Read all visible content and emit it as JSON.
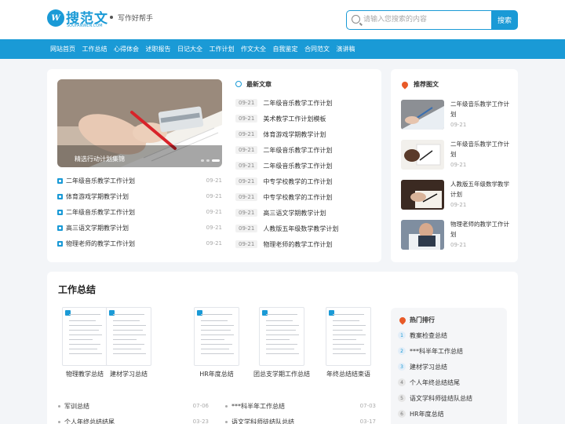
{
  "header": {
    "logo_mark": "W",
    "logo_text": "搜范文",
    "logo_sub": "SOUFANWEN.COM",
    "slogan": "写作好帮手",
    "search_placeholder": "请输入您搜索的内容",
    "search_button": "搜索"
  },
  "nav": {
    "items": [
      "网站首页",
      "工作总结",
      "心得体会",
      "述职报告",
      "日记大全",
      "工作计划",
      "作文大全",
      "自我鉴定",
      "合同范文",
      "演讲稿"
    ]
  },
  "feature": {
    "hero_caption": "精选行动计划集锦",
    "list": [
      {
        "title": "二年级音乐教学工作计划",
        "date": "09-21"
      },
      {
        "title": "体育游戏学期教学计划",
        "date": "09-21"
      },
      {
        "title": "二年级音乐教学工作计划",
        "date": "09-21"
      },
      {
        "title": "高三语文学期教学计划",
        "date": "09-21"
      },
      {
        "title": "物理老师的教学工作计划",
        "date": "09-21"
      }
    ]
  },
  "latest": {
    "title": "最新文章",
    "items": [
      {
        "date": "09-21",
        "title": "二年级音乐教学工作计划"
      },
      {
        "date": "09-21",
        "title": "美术教学工作计划模板"
      },
      {
        "date": "09-21",
        "title": "体育游戏学期教学计划"
      },
      {
        "date": "09-21",
        "title": "二年级音乐教学工作计划"
      },
      {
        "date": "09-21",
        "title": "二年级音乐教学工作计划"
      },
      {
        "date": "09-21",
        "title": "中专学校教学的工作计划"
      },
      {
        "date": "09-21",
        "title": "中专学校教学的工作计划"
      },
      {
        "date": "09-21",
        "title": "高三语文学期教学计划"
      },
      {
        "date": "09-21",
        "title": "人教版五年级数学教学计划"
      },
      {
        "date": "09-21",
        "title": "物理老师的教学工作计划"
      }
    ]
  },
  "recommend": {
    "title": "推荐图文",
    "items": [
      {
        "title": "二年级音乐教学工作计划",
        "date": "09-21"
      },
      {
        "title": "二年级音乐教学工作计划",
        "date": "09-21"
      },
      {
        "title": "人教版五年级数学教学计划",
        "date": "09-21"
      },
      {
        "title": "物理老师的教学工作计划",
        "date": "09-21"
      }
    ]
  },
  "summary": {
    "title": "工作总结",
    "docs": [
      "物理教学总结",
      "建材学习总结",
      "HR年度总结",
      "团总支学期工作总结",
      "年终总结结束语"
    ],
    "list_left": [
      {
        "title": "军训总结",
        "date": "07-06"
      },
      {
        "title": "个人年终总结结尾",
        "date": "03-23"
      }
    ],
    "list_right": [
      {
        "title": "***科半年工作总结",
        "date": "07-03"
      },
      {
        "title": "语文学科师徒结队总结",
        "date": "03-17"
      }
    ]
  },
  "hot": {
    "title": "热门排行",
    "items": [
      {
        "rank": "1",
        "title": "教案检查总结"
      },
      {
        "rank": "2",
        "title": "***科半年工作总结"
      },
      {
        "rank": "3",
        "title": "建材学习总结"
      },
      {
        "rank": "4",
        "title": "个人年终总结结尾"
      },
      {
        "rank": "5",
        "title": "语文学科师徒结队总结"
      },
      {
        "rank": "6",
        "title": "HR年度总结"
      }
    ]
  }
}
